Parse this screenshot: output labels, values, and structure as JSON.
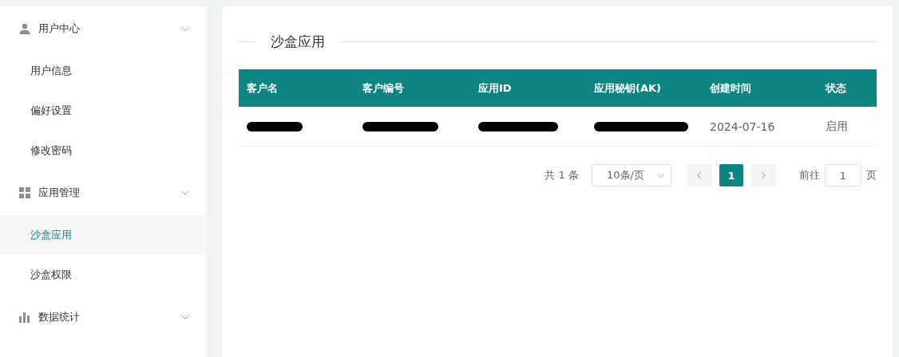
{
  "sidebar": {
    "groups": [
      {
        "label": "用户中心",
        "expanded": true,
        "items": [
          {
            "label": "用户信息",
            "selected": false
          },
          {
            "label": "偏好设置",
            "selected": false
          },
          {
            "label": "修改密码",
            "selected": false
          }
        ]
      },
      {
        "label": "应用管理",
        "expanded": true,
        "items": [
          {
            "label": "沙盒应用",
            "selected": true
          },
          {
            "label": "沙盒权限",
            "selected": false
          }
        ]
      },
      {
        "label": "数据统计",
        "expanded": true
      }
    ]
  },
  "panel": {
    "title": "沙盒应用",
    "table": {
      "columns": [
        "客户名",
        "客户编号",
        "应用ID",
        "应用秘钥(AK)",
        "创建时间",
        "状态"
      ],
      "rows": [
        {
          "cells": [
            {
              "kind": "redacted"
            },
            {
              "kind": "redacted"
            },
            {
              "kind": "redacted"
            },
            {
              "kind": "redacted"
            },
            {
              "kind": "text",
              "text": "2024-07-16"
            },
            {
              "kind": "text",
              "text": "启用"
            }
          ]
        }
      ]
    },
    "pagination": {
      "total": "共 1 条",
      "page_size": "10条/页",
      "pages": [
        {
          "label": "1",
          "selected": true
        }
      ],
      "goto_label": "前往",
      "goto_value": "1",
      "goto_suffix": "页"
    }
  }
}
